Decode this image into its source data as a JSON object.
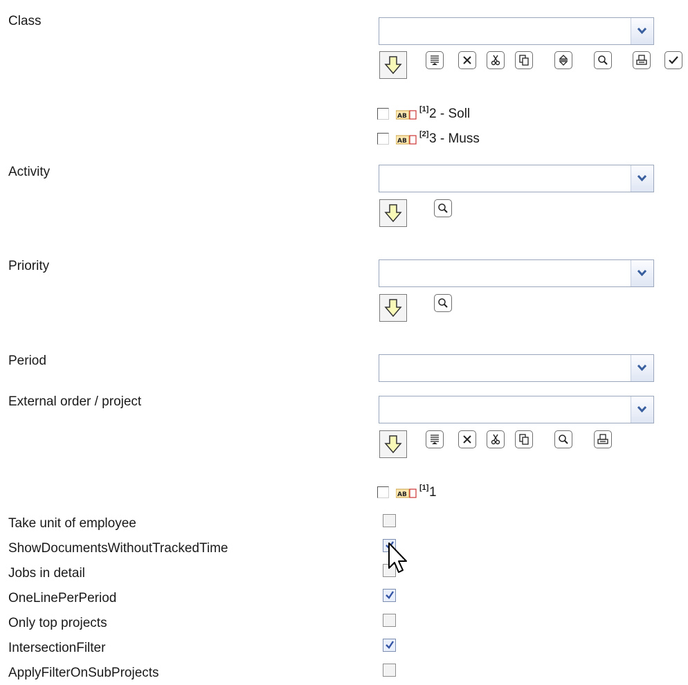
{
  "labels": {
    "class": "Class",
    "activity": "Activity",
    "priority": "Priority",
    "period": "Period",
    "external_order": "External order / project",
    "take_unit": "Take unit of employee",
    "show_docs": "ShowDocumentsWithoutTrackedTime",
    "jobs_detail": "Jobs in detail",
    "one_line": "OneLinePerPeriod",
    "only_top": "Only top projects",
    "intersection": "IntersectionFilter",
    "apply_sub": "ApplyFilterOnSubProjects"
  },
  "class_selection": {
    "items": [
      {
        "index": "[1]",
        "text": "2 - Soll",
        "checked": false
      },
      {
        "index": "[2]",
        "text": "3 - Muss",
        "checked": false
      }
    ]
  },
  "external_selection": {
    "items": [
      {
        "index": "[1]",
        "text": "1",
        "checked": false
      }
    ]
  },
  "options": {
    "take_unit": false,
    "show_docs": true,
    "jobs_detail": false,
    "one_line": true,
    "only_top": false,
    "intersection": true,
    "apply_sub": false
  },
  "icons": {
    "add": "arrow-down-icon",
    "list": "list-icon",
    "clear": "clear-icon",
    "cut": "cut-icon",
    "copy": "copy-icon",
    "sort": "sort-icon",
    "search": "search-icon",
    "print": "print-icon",
    "confirm": "check-icon"
  },
  "colors": {
    "combo_border": "#9aa6bc",
    "arrow_blue": "#3a5f9f",
    "down_arrow_fill": "#fafab8",
    "check_blue": "#3454a6"
  }
}
